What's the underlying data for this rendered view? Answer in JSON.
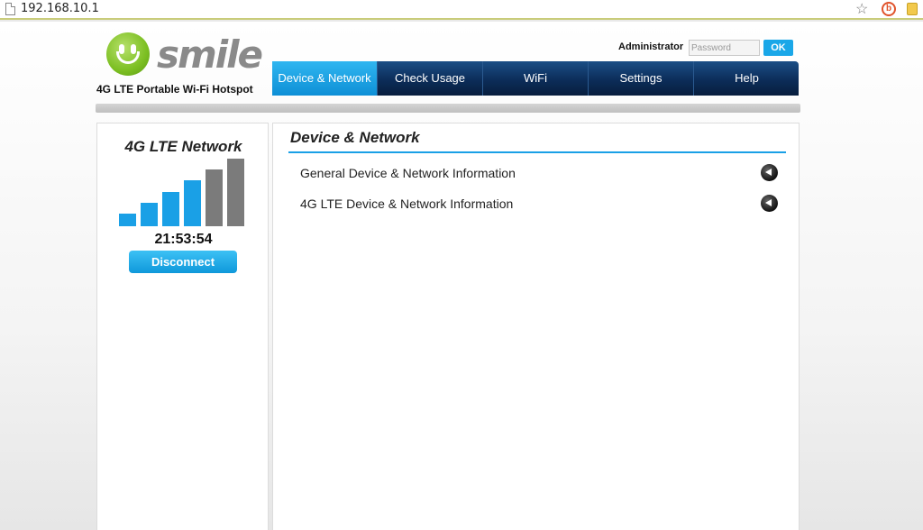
{
  "browser": {
    "url": "192.168.10.1",
    "icons": [
      "page-icon",
      "star-icon",
      "extension-icon",
      "notes-icon"
    ]
  },
  "header": {
    "logo_text": "smile",
    "tagline": "4G LTE Portable Wi-Fi Hotspot",
    "admin_label": "Administrator",
    "password_placeholder": "Password",
    "ok_label": "OK"
  },
  "nav": {
    "tabs": [
      {
        "label": "Device & Network",
        "active": true
      },
      {
        "label": "Check Usage",
        "active": false
      },
      {
        "label": "WiFi",
        "active": false
      },
      {
        "label": "Settings",
        "active": false
      },
      {
        "label": "Help",
        "active": false
      }
    ]
  },
  "status": {
    "network_title": "4G LTE Network",
    "signal_bars_total": 6,
    "signal_bars_active": 4,
    "time": "21:53:54",
    "disconnect_label": "Disconnect"
  },
  "main": {
    "title": "Device & Network",
    "items": [
      {
        "label": "General Device & Network Information",
        "icon": "arrow-left-icon"
      },
      {
        "label": "4G LTE Device & Network Information",
        "icon": "arrow-left-icon"
      }
    ]
  },
  "colors": {
    "accent": "#1aa7e8",
    "nav_dark": "#0c2d59",
    "signal_active": "#1aa0e6",
    "signal_inactive": "#7b7b7b",
    "logo_green": "#7cbf22"
  }
}
